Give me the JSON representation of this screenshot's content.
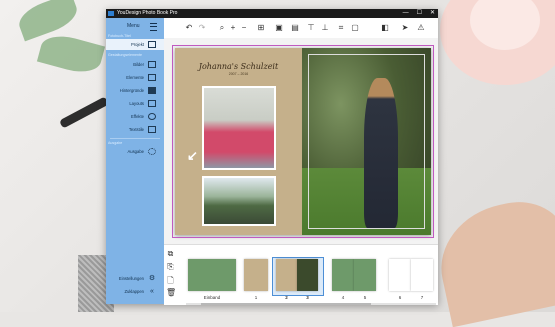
{
  "window": {
    "title": "YouDesign Photo Book Pro",
    "controls": [
      "—",
      "☐",
      "✕"
    ]
  },
  "sidebar": {
    "menu_label": "Menu",
    "sections": {
      "s1": "Fotobuch-Titel",
      "s2": "Gestaltungselemente",
      "s3": "Ausgabe"
    },
    "items": [
      {
        "label": "Projekt",
        "icon": "project-icon",
        "active": true
      },
      {
        "label": "Bilder",
        "icon": "image-icon"
      },
      {
        "label": "Elemente",
        "icon": "elements-icon"
      },
      {
        "label": "Hintergründe",
        "icon": "background-icon"
      },
      {
        "label": "Layouts",
        "icon": "layout-icon"
      },
      {
        "label": "Effekte",
        "icon": "effects-icon"
      },
      {
        "label": "Textstile",
        "icon": "text-style-icon"
      },
      {
        "label": "Ausgabe",
        "icon": "output-icon"
      }
    ],
    "footer": [
      {
        "label": "Einstellungen",
        "icon": "gear-icon"
      },
      {
        "label": "Zuklappen",
        "icon": "collapse-icon"
      }
    ]
  },
  "toolbar": {
    "icons": [
      "undo-icon",
      "redo-icon",
      "zoom-icon",
      "zoom-in-icon",
      "zoom-out-icon",
      "grid-icon",
      "align-icon",
      "arrange-icon",
      "layer-up-icon",
      "layer-down-icon",
      "crop-icon",
      "frame-icon",
      "color-icon",
      "send-icon",
      "warning-icon"
    ]
  },
  "page": {
    "title": "Johanna's Schulzeit",
    "subtitle": "2007 – 2016"
  },
  "pages_strip": {
    "labels": [
      "Einband",
      "1",
      "2",
      "3",
      "4",
      "5",
      "6",
      "7"
    ]
  },
  "colors": {
    "sidebar": "#7fb3e6",
    "accent": "#4d8fd6",
    "page_bg": "#c5b08b"
  }
}
